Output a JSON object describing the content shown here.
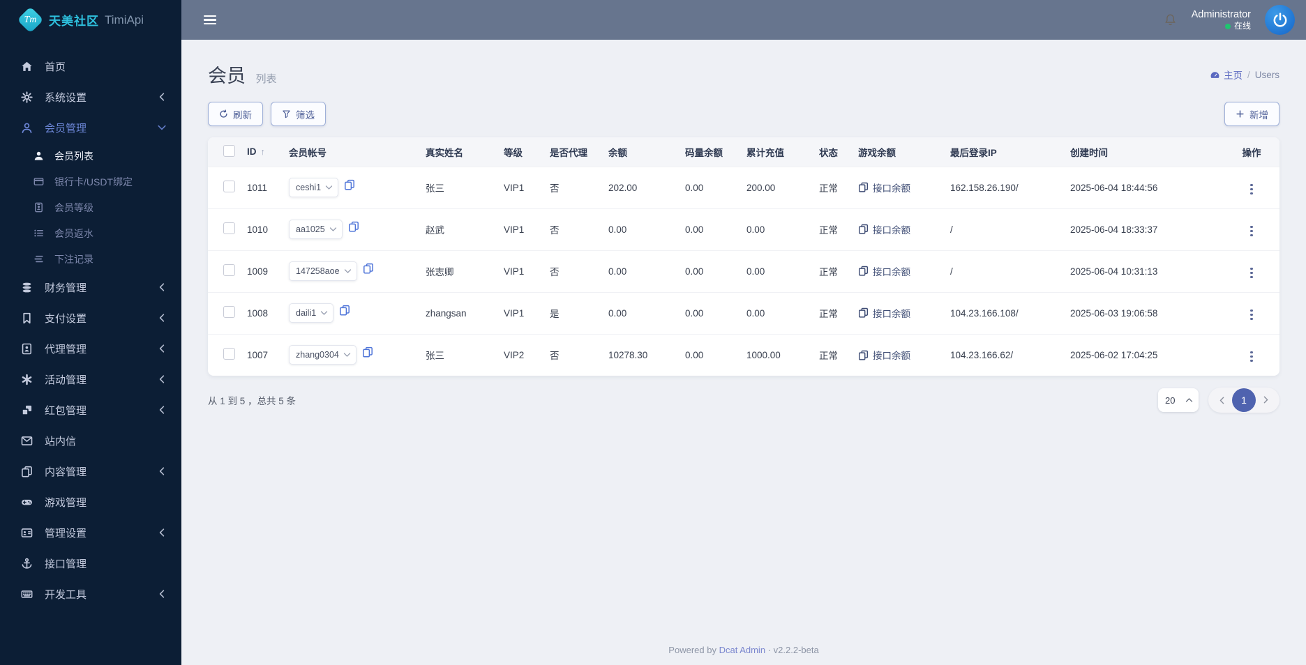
{
  "colors": {
    "sidebar_bg": "#0c1e35",
    "topbar_bg": "#67758e",
    "accent_indigo": "#4f63af",
    "breadcrumb_link": "#5a68c0",
    "copy_icon_blue": "#4e74d8",
    "online_green": "#1fc56f",
    "brand_teal": "#2ec0dd",
    "avatar_blue": "#1e79dd"
  },
  "brand": {
    "logo": "Tm",
    "name_cn": "天美社区",
    "name_en": "TimiApi"
  },
  "topbar": {
    "username": "Administrator",
    "online_status": "在线"
  },
  "sidebar": {
    "items": [
      {
        "icon": "home",
        "label": "首页"
      },
      {
        "icon": "gears",
        "label": "系统设置",
        "chevron": "left"
      },
      {
        "icon": "user",
        "label": "会员管理",
        "chevron": "down",
        "active": true,
        "children": [
          {
            "icon": "user-solid",
            "label": "会员列表",
            "active": true
          },
          {
            "icon": "credit-card",
            "label": "银行卡/USDT绑定"
          },
          {
            "icon": "id-badge",
            "label": "会员等级"
          },
          {
            "icon": "list",
            "label": "会员返水"
          },
          {
            "icon": "stream",
            "label": "下注记录"
          }
        ]
      },
      {
        "icon": "database",
        "label": "财务管理",
        "chevron": "left"
      },
      {
        "icon": "bookmark",
        "label": "支付设置",
        "chevron": "left"
      },
      {
        "icon": "address-book",
        "label": "代理管理",
        "chevron": "left"
      },
      {
        "icon": "asterisk",
        "label": "活动管理",
        "chevron": "left"
      },
      {
        "icon": "cubes",
        "label": "红包管理",
        "chevron": "left"
      },
      {
        "icon": "envelope",
        "label": "站内信"
      },
      {
        "icon": "copy-dark",
        "label": "内容管理",
        "chevron": "left"
      },
      {
        "icon": "gamepad",
        "label": "游戏管理"
      },
      {
        "icon": "address-card",
        "label": "管理设置",
        "chevron": "left"
      },
      {
        "icon": "anchor",
        "label": "接口管理"
      },
      {
        "icon": "keyboard",
        "label": "开发工具",
        "chevron": "left"
      }
    ]
  },
  "page": {
    "title": "会员",
    "subtitle": "列表",
    "breadcrumb_home": "主页",
    "breadcrumb_sep": "/",
    "breadcrumb_current": "Users"
  },
  "toolbar": {
    "refresh_label": "刷新",
    "filter_label": "筛选",
    "add_label": "新增"
  },
  "table": {
    "columns": [
      {
        "key": "id",
        "label": "ID",
        "sortable": true
      },
      {
        "key": "account",
        "label": "会员帐号"
      },
      {
        "key": "name",
        "label": "真实姓名"
      },
      {
        "key": "level",
        "label": "等级"
      },
      {
        "key": "agent",
        "label": "是否代理"
      },
      {
        "key": "balance",
        "label": "余额"
      },
      {
        "key": "code_balance",
        "label": "码量余额"
      },
      {
        "key": "total_recharge",
        "label": "累计充值"
      },
      {
        "key": "status",
        "label": "状态"
      },
      {
        "key": "game_balance",
        "label": "游戏余额"
      },
      {
        "key": "last_ip",
        "label": "最后登录IP"
      },
      {
        "key": "created",
        "label": "创建时间"
      },
      {
        "key": "actions",
        "label": "操作"
      }
    ],
    "rows": [
      {
        "id": "1011",
        "account": "ceshi1",
        "name": "张三",
        "level": "VIP1",
        "agent": "否",
        "balance": "202.00",
        "code_balance": "0.00",
        "total_recharge": "200.00",
        "status": "正常",
        "game_balance": "接口余额",
        "last_ip": "162.158.26.190/",
        "created": "2025-06-04 18:44:56"
      },
      {
        "id": "1010",
        "account": "aa1025",
        "name": "赵武",
        "level": "VIP1",
        "agent": "否",
        "balance": "0.00",
        "code_balance": "0.00",
        "total_recharge": "0.00",
        "status": "正常",
        "game_balance": "接口余额",
        "last_ip": "/",
        "created": "2025-06-04 18:33:37"
      },
      {
        "id": "1009",
        "account": "147258aoe",
        "name": "张志卿",
        "level": "VIP1",
        "agent": "否",
        "balance": "0.00",
        "code_balance": "0.00",
        "total_recharge": "0.00",
        "status": "正常",
        "game_balance": "接口余额",
        "last_ip": "/",
        "created": "2025-06-04 10:31:13"
      },
      {
        "id": "1008",
        "account": "daili1",
        "name": "zhangsan",
        "level": "VIP1",
        "agent": "是",
        "balance": "0.00",
        "code_balance": "0.00",
        "total_recharge": "0.00",
        "status": "正常",
        "game_balance": "接口余额",
        "last_ip": "104.23.166.108/",
        "created": "2025-06-03 19:06:58"
      },
      {
        "id": "1007",
        "account": "zhang0304",
        "name": "张三",
        "level": "VIP2",
        "agent": "否",
        "balance": "10278.30",
        "code_balance": "0.00",
        "total_recharge": "1000.00",
        "status": "正常",
        "game_balance": "接口余额",
        "last_ip": "104.23.166.62/",
        "created": "2025-06-02 17:04:25"
      }
    ]
  },
  "pagination": {
    "summary": "从 1 到 5 ，总共 5 条",
    "page_size": "20",
    "current_page": "1"
  },
  "footer": {
    "powered_by": "Powered by",
    "link": "Dcat Admin",
    "separator": "·",
    "version": "v2.2.2-beta"
  }
}
